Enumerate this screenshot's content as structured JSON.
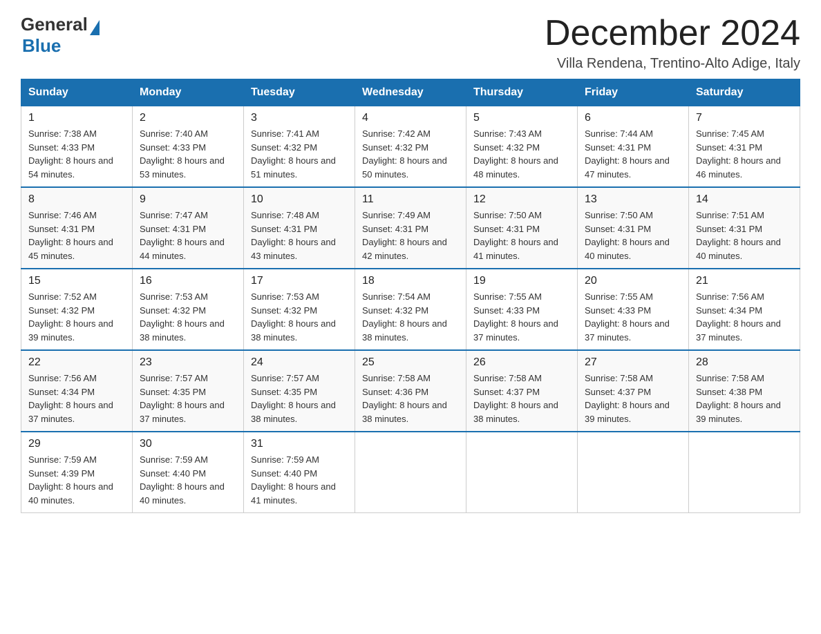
{
  "header": {
    "logo_general": "General",
    "logo_blue": "Blue",
    "title": "December 2024",
    "location": "Villa Rendena, Trentino-Alto Adige, Italy"
  },
  "days_of_week": [
    "Sunday",
    "Monday",
    "Tuesday",
    "Wednesday",
    "Thursday",
    "Friday",
    "Saturday"
  ],
  "weeks": [
    [
      {
        "day": "1",
        "sunrise": "7:38 AM",
        "sunset": "4:33 PM",
        "daylight": "8 hours and 54 minutes."
      },
      {
        "day": "2",
        "sunrise": "7:40 AM",
        "sunset": "4:33 PM",
        "daylight": "8 hours and 53 minutes."
      },
      {
        "day": "3",
        "sunrise": "7:41 AM",
        "sunset": "4:32 PM",
        "daylight": "8 hours and 51 minutes."
      },
      {
        "day": "4",
        "sunrise": "7:42 AM",
        "sunset": "4:32 PM",
        "daylight": "8 hours and 50 minutes."
      },
      {
        "day": "5",
        "sunrise": "7:43 AM",
        "sunset": "4:32 PM",
        "daylight": "8 hours and 48 minutes."
      },
      {
        "day": "6",
        "sunrise": "7:44 AM",
        "sunset": "4:31 PM",
        "daylight": "8 hours and 47 minutes."
      },
      {
        "day": "7",
        "sunrise": "7:45 AM",
        "sunset": "4:31 PM",
        "daylight": "8 hours and 46 minutes."
      }
    ],
    [
      {
        "day": "8",
        "sunrise": "7:46 AM",
        "sunset": "4:31 PM",
        "daylight": "8 hours and 45 minutes."
      },
      {
        "day": "9",
        "sunrise": "7:47 AM",
        "sunset": "4:31 PM",
        "daylight": "8 hours and 44 minutes."
      },
      {
        "day": "10",
        "sunrise": "7:48 AM",
        "sunset": "4:31 PM",
        "daylight": "8 hours and 43 minutes."
      },
      {
        "day": "11",
        "sunrise": "7:49 AM",
        "sunset": "4:31 PM",
        "daylight": "8 hours and 42 minutes."
      },
      {
        "day": "12",
        "sunrise": "7:50 AM",
        "sunset": "4:31 PM",
        "daylight": "8 hours and 41 minutes."
      },
      {
        "day": "13",
        "sunrise": "7:50 AM",
        "sunset": "4:31 PM",
        "daylight": "8 hours and 40 minutes."
      },
      {
        "day": "14",
        "sunrise": "7:51 AM",
        "sunset": "4:31 PM",
        "daylight": "8 hours and 40 minutes."
      }
    ],
    [
      {
        "day": "15",
        "sunrise": "7:52 AM",
        "sunset": "4:32 PM",
        "daylight": "8 hours and 39 minutes."
      },
      {
        "day": "16",
        "sunrise": "7:53 AM",
        "sunset": "4:32 PM",
        "daylight": "8 hours and 38 minutes."
      },
      {
        "day": "17",
        "sunrise": "7:53 AM",
        "sunset": "4:32 PM",
        "daylight": "8 hours and 38 minutes."
      },
      {
        "day": "18",
        "sunrise": "7:54 AM",
        "sunset": "4:32 PM",
        "daylight": "8 hours and 38 minutes."
      },
      {
        "day": "19",
        "sunrise": "7:55 AM",
        "sunset": "4:33 PM",
        "daylight": "8 hours and 37 minutes."
      },
      {
        "day": "20",
        "sunrise": "7:55 AM",
        "sunset": "4:33 PM",
        "daylight": "8 hours and 37 minutes."
      },
      {
        "day": "21",
        "sunrise": "7:56 AM",
        "sunset": "4:34 PM",
        "daylight": "8 hours and 37 minutes."
      }
    ],
    [
      {
        "day": "22",
        "sunrise": "7:56 AM",
        "sunset": "4:34 PM",
        "daylight": "8 hours and 37 minutes."
      },
      {
        "day": "23",
        "sunrise": "7:57 AM",
        "sunset": "4:35 PM",
        "daylight": "8 hours and 37 minutes."
      },
      {
        "day": "24",
        "sunrise": "7:57 AM",
        "sunset": "4:35 PM",
        "daylight": "8 hours and 38 minutes."
      },
      {
        "day": "25",
        "sunrise": "7:58 AM",
        "sunset": "4:36 PM",
        "daylight": "8 hours and 38 minutes."
      },
      {
        "day": "26",
        "sunrise": "7:58 AM",
        "sunset": "4:37 PM",
        "daylight": "8 hours and 38 minutes."
      },
      {
        "day": "27",
        "sunrise": "7:58 AM",
        "sunset": "4:37 PM",
        "daylight": "8 hours and 39 minutes."
      },
      {
        "day": "28",
        "sunrise": "7:58 AM",
        "sunset": "4:38 PM",
        "daylight": "8 hours and 39 minutes."
      }
    ],
    [
      {
        "day": "29",
        "sunrise": "7:59 AM",
        "sunset": "4:39 PM",
        "daylight": "8 hours and 40 minutes."
      },
      {
        "day": "30",
        "sunrise": "7:59 AM",
        "sunset": "4:40 PM",
        "daylight": "8 hours and 40 minutes."
      },
      {
        "day": "31",
        "sunrise": "7:59 AM",
        "sunset": "4:40 PM",
        "daylight": "8 hours and 41 minutes."
      },
      null,
      null,
      null,
      null
    ]
  ]
}
